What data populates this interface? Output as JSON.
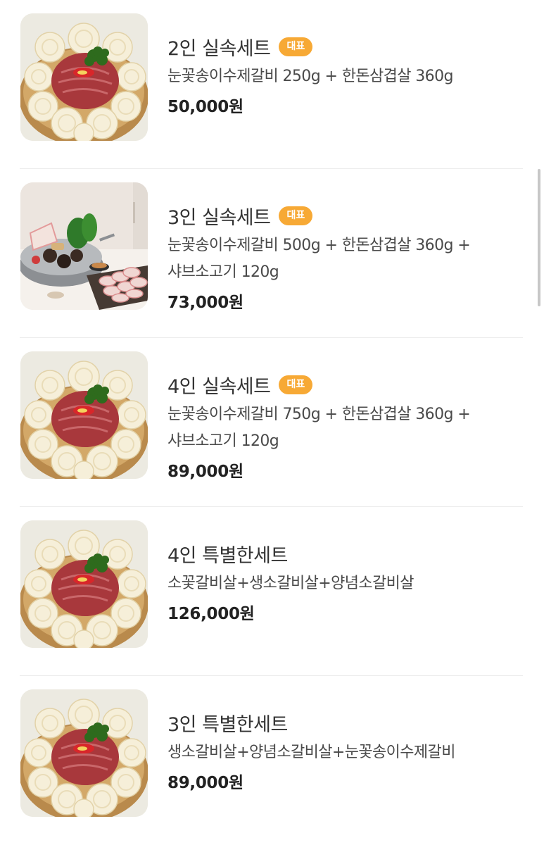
{
  "menu": {
    "items": [
      {
        "title": "2인 실속세트",
        "badge": "대표",
        "description": "눈꽃송이수제갈비 250g + 한돈삼겹살 360g",
        "price": "50,000원",
        "image": "beef-platter-image"
      },
      {
        "title": "3인 실속세트",
        "badge": "대표",
        "description": "눈꽃송이수제갈비 500g + 한돈삼겹살 360g + 샤브소고기 120g",
        "price": "73,000원",
        "image": "shabu-hotpot-image"
      },
      {
        "title": "4인 실속세트",
        "badge": "대표",
        "description": "눈꽃송이수제갈비 750g + 한돈삼겹살 360g + 샤브소고기 120g",
        "price": "89,000원",
        "image": "beef-platter-image"
      },
      {
        "title": "4인 특별한세트",
        "badge": "",
        "description": "소꽃갈비살+생소갈비살+양념소갈비살",
        "price": "126,000원",
        "image": "beef-platter-image"
      },
      {
        "title": "3인 특별한세트",
        "badge": "",
        "description": "생소갈비살+양념소갈비살+눈꽃송이수제갈비",
        "price": "89,000원",
        "image": "beef-platter-image"
      }
    ]
  },
  "colors": {
    "badge": "#f7a935",
    "divider": "#ececec",
    "price": "#222222"
  }
}
